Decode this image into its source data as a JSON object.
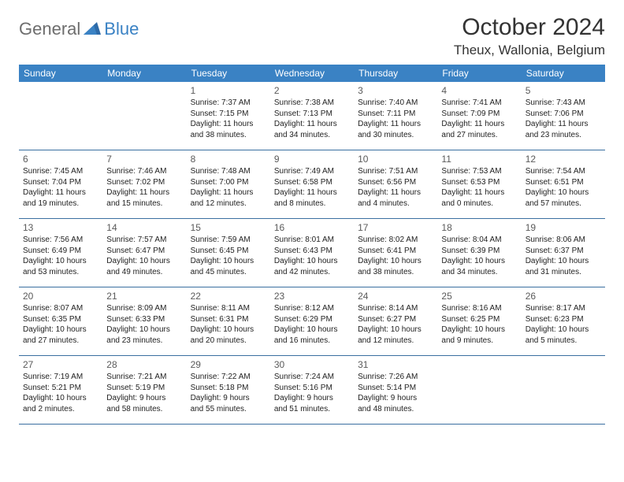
{
  "logo": {
    "part1": "General",
    "part2": "Blue"
  },
  "title": "October 2024",
  "location": "Theux, Wallonia, Belgium",
  "weekdays": [
    "Sunday",
    "Monday",
    "Tuesday",
    "Wednesday",
    "Thursday",
    "Friday",
    "Saturday"
  ],
  "weeks": [
    [
      null,
      null,
      {
        "num": "1",
        "sunrise": "Sunrise: 7:37 AM",
        "sunset": "Sunset: 7:15 PM",
        "day1": "Daylight: 11 hours",
        "day2": "and 38 minutes."
      },
      {
        "num": "2",
        "sunrise": "Sunrise: 7:38 AM",
        "sunset": "Sunset: 7:13 PM",
        "day1": "Daylight: 11 hours",
        "day2": "and 34 minutes."
      },
      {
        "num": "3",
        "sunrise": "Sunrise: 7:40 AM",
        "sunset": "Sunset: 7:11 PM",
        "day1": "Daylight: 11 hours",
        "day2": "and 30 minutes."
      },
      {
        "num": "4",
        "sunrise": "Sunrise: 7:41 AM",
        "sunset": "Sunset: 7:09 PM",
        "day1": "Daylight: 11 hours",
        "day2": "and 27 minutes."
      },
      {
        "num": "5",
        "sunrise": "Sunrise: 7:43 AM",
        "sunset": "Sunset: 7:06 PM",
        "day1": "Daylight: 11 hours",
        "day2": "and 23 minutes."
      }
    ],
    [
      {
        "num": "6",
        "sunrise": "Sunrise: 7:45 AM",
        "sunset": "Sunset: 7:04 PM",
        "day1": "Daylight: 11 hours",
        "day2": "and 19 minutes."
      },
      {
        "num": "7",
        "sunrise": "Sunrise: 7:46 AM",
        "sunset": "Sunset: 7:02 PM",
        "day1": "Daylight: 11 hours",
        "day2": "and 15 minutes."
      },
      {
        "num": "8",
        "sunrise": "Sunrise: 7:48 AM",
        "sunset": "Sunset: 7:00 PM",
        "day1": "Daylight: 11 hours",
        "day2": "and 12 minutes."
      },
      {
        "num": "9",
        "sunrise": "Sunrise: 7:49 AM",
        "sunset": "Sunset: 6:58 PM",
        "day1": "Daylight: 11 hours",
        "day2": "and 8 minutes."
      },
      {
        "num": "10",
        "sunrise": "Sunrise: 7:51 AM",
        "sunset": "Sunset: 6:56 PM",
        "day1": "Daylight: 11 hours",
        "day2": "and 4 minutes."
      },
      {
        "num": "11",
        "sunrise": "Sunrise: 7:53 AM",
        "sunset": "Sunset: 6:53 PM",
        "day1": "Daylight: 11 hours",
        "day2": "and 0 minutes."
      },
      {
        "num": "12",
        "sunrise": "Sunrise: 7:54 AM",
        "sunset": "Sunset: 6:51 PM",
        "day1": "Daylight: 10 hours",
        "day2": "and 57 minutes."
      }
    ],
    [
      {
        "num": "13",
        "sunrise": "Sunrise: 7:56 AM",
        "sunset": "Sunset: 6:49 PM",
        "day1": "Daylight: 10 hours",
        "day2": "and 53 minutes."
      },
      {
        "num": "14",
        "sunrise": "Sunrise: 7:57 AM",
        "sunset": "Sunset: 6:47 PM",
        "day1": "Daylight: 10 hours",
        "day2": "and 49 minutes."
      },
      {
        "num": "15",
        "sunrise": "Sunrise: 7:59 AM",
        "sunset": "Sunset: 6:45 PM",
        "day1": "Daylight: 10 hours",
        "day2": "and 45 minutes."
      },
      {
        "num": "16",
        "sunrise": "Sunrise: 8:01 AM",
        "sunset": "Sunset: 6:43 PM",
        "day1": "Daylight: 10 hours",
        "day2": "and 42 minutes."
      },
      {
        "num": "17",
        "sunrise": "Sunrise: 8:02 AM",
        "sunset": "Sunset: 6:41 PM",
        "day1": "Daylight: 10 hours",
        "day2": "and 38 minutes."
      },
      {
        "num": "18",
        "sunrise": "Sunrise: 8:04 AM",
        "sunset": "Sunset: 6:39 PM",
        "day1": "Daylight: 10 hours",
        "day2": "and 34 minutes."
      },
      {
        "num": "19",
        "sunrise": "Sunrise: 8:06 AM",
        "sunset": "Sunset: 6:37 PM",
        "day1": "Daylight: 10 hours",
        "day2": "and 31 minutes."
      }
    ],
    [
      {
        "num": "20",
        "sunrise": "Sunrise: 8:07 AM",
        "sunset": "Sunset: 6:35 PM",
        "day1": "Daylight: 10 hours",
        "day2": "and 27 minutes."
      },
      {
        "num": "21",
        "sunrise": "Sunrise: 8:09 AM",
        "sunset": "Sunset: 6:33 PM",
        "day1": "Daylight: 10 hours",
        "day2": "and 23 minutes."
      },
      {
        "num": "22",
        "sunrise": "Sunrise: 8:11 AM",
        "sunset": "Sunset: 6:31 PM",
        "day1": "Daylight: 10 hours",
        "day2": "and 20 minutes."
      },
      {
        "num": "23",
        "sunrise": "Sunrise: 8:12 AM",
        "sunset": "Sunset: 6:29 PM",
        "day1": "Daylight: 10 hours",
        "day2": "and 16 minutes."
      },
      {
        "num": "24",
        "sunrise": "Sunrise: 8:14 AM",
        "sunset": "Sunset: 6:27 PM",
        "day1": "Daylight: 10 hours",
        "day2": "and 12 minutes."
      },
      {
        "num": "25",
        "sunrise": "Sunrise: 8:16 AM",
        "sunset": "Sunset: 6:25 PM",
        "day1": "Daylight: 10 hours",
        "day2": "and 9 minutes."
      },
      {
        "num": "26",
        "sunrise": "Sunrise: 8:17 AM",
        "sunset": "Sunset: 6:23 PM",
        "day1": "Daylight: 10 hours",
        "day2": "and 5 minutes."
      }
    ],
    [
      {
        "num": "27",
        "sunrise": "Sunrise: 7:19 AM",
        "sunset": "Sunset: 5:21 PM",
        "day1": "Daylight: 10 hours",
        "day2": "and 2 minutes."
      },
      {
        "num": "28",
        "sunrise": "Sunrise: 7:21 AM",
        "sunset": "Sunset: 5:19 PM",
        "day1": "Daylight: 9 hours",
        "day2": "and 58 minutes."
      },
      {
        "num": "29",
        "sunrise": "Sunrise: 7:22 AM",
        "sunset": "Sunset: 5:18 PM",
        "day1": "Daylight: 9 hours",
        "day2": "and 55 minutes."
      },
      {
        "num": "30",
        "sunrise": "Sunrise: 7:24 AM",
        "sunset": "Sunset: 5:16 PM",
        "day1": "Daylight: 9 hours",
        "day2": "and 51 minutes."
      },
      {
        "num": "31",
        "sunrise": "Sunrise: 7:26 AM",
        "sunset": "Sunset: 5:14 PM",
        "day1": "Daylight: 9 hours",
        "day2": "and 48 minutes."
      },
      null,
      null
    ]
  ]
}
